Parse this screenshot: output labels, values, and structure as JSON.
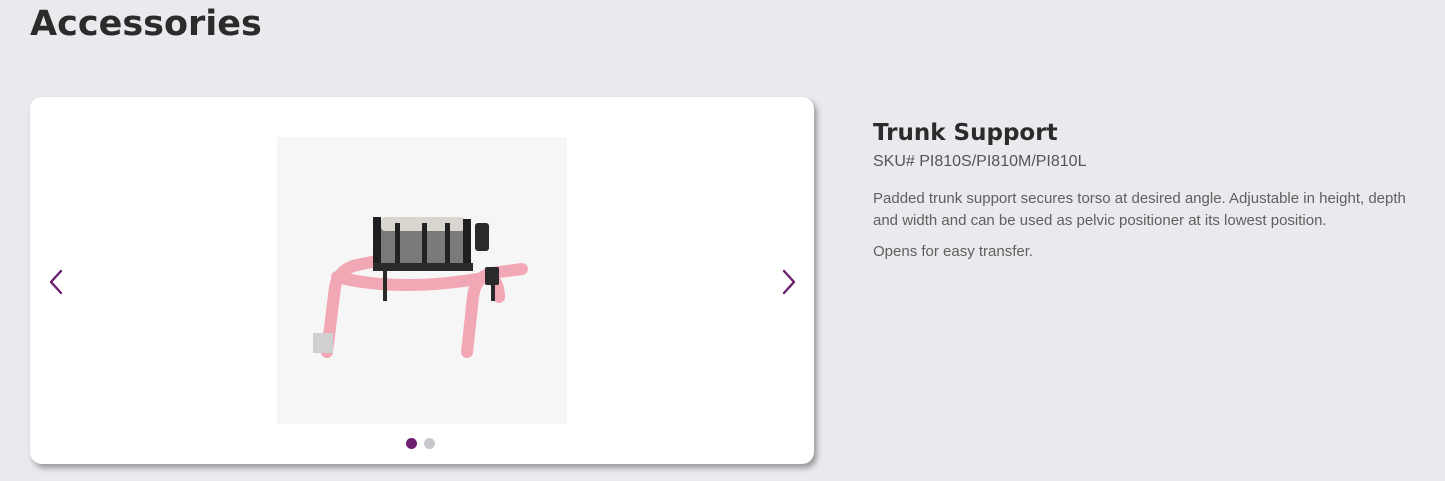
{
  "page": {
    "title": "Accessories"
  },
  "carousel": {
    "prev_icon": "chevron-left-icon",
    "next_icon": "chevron-right-icon",
    "accent_color": "#6b1f6e",
    "slide_count": 2,
    "active_slide": 1,
    "image_subject": "trunk support mounted on pink walker frame"
  },
  "product": {
    "name": "Trunk Support",
    "sku": "SKU# PI810S/PI810M/PI810L",
    "description": "Padded trunk support secures torso at desired angle. Adjustable in height, depth and width and can be used as pelvic positioner at its lowest position.",
    "note": "Opens for easy transfer."
  }
}
